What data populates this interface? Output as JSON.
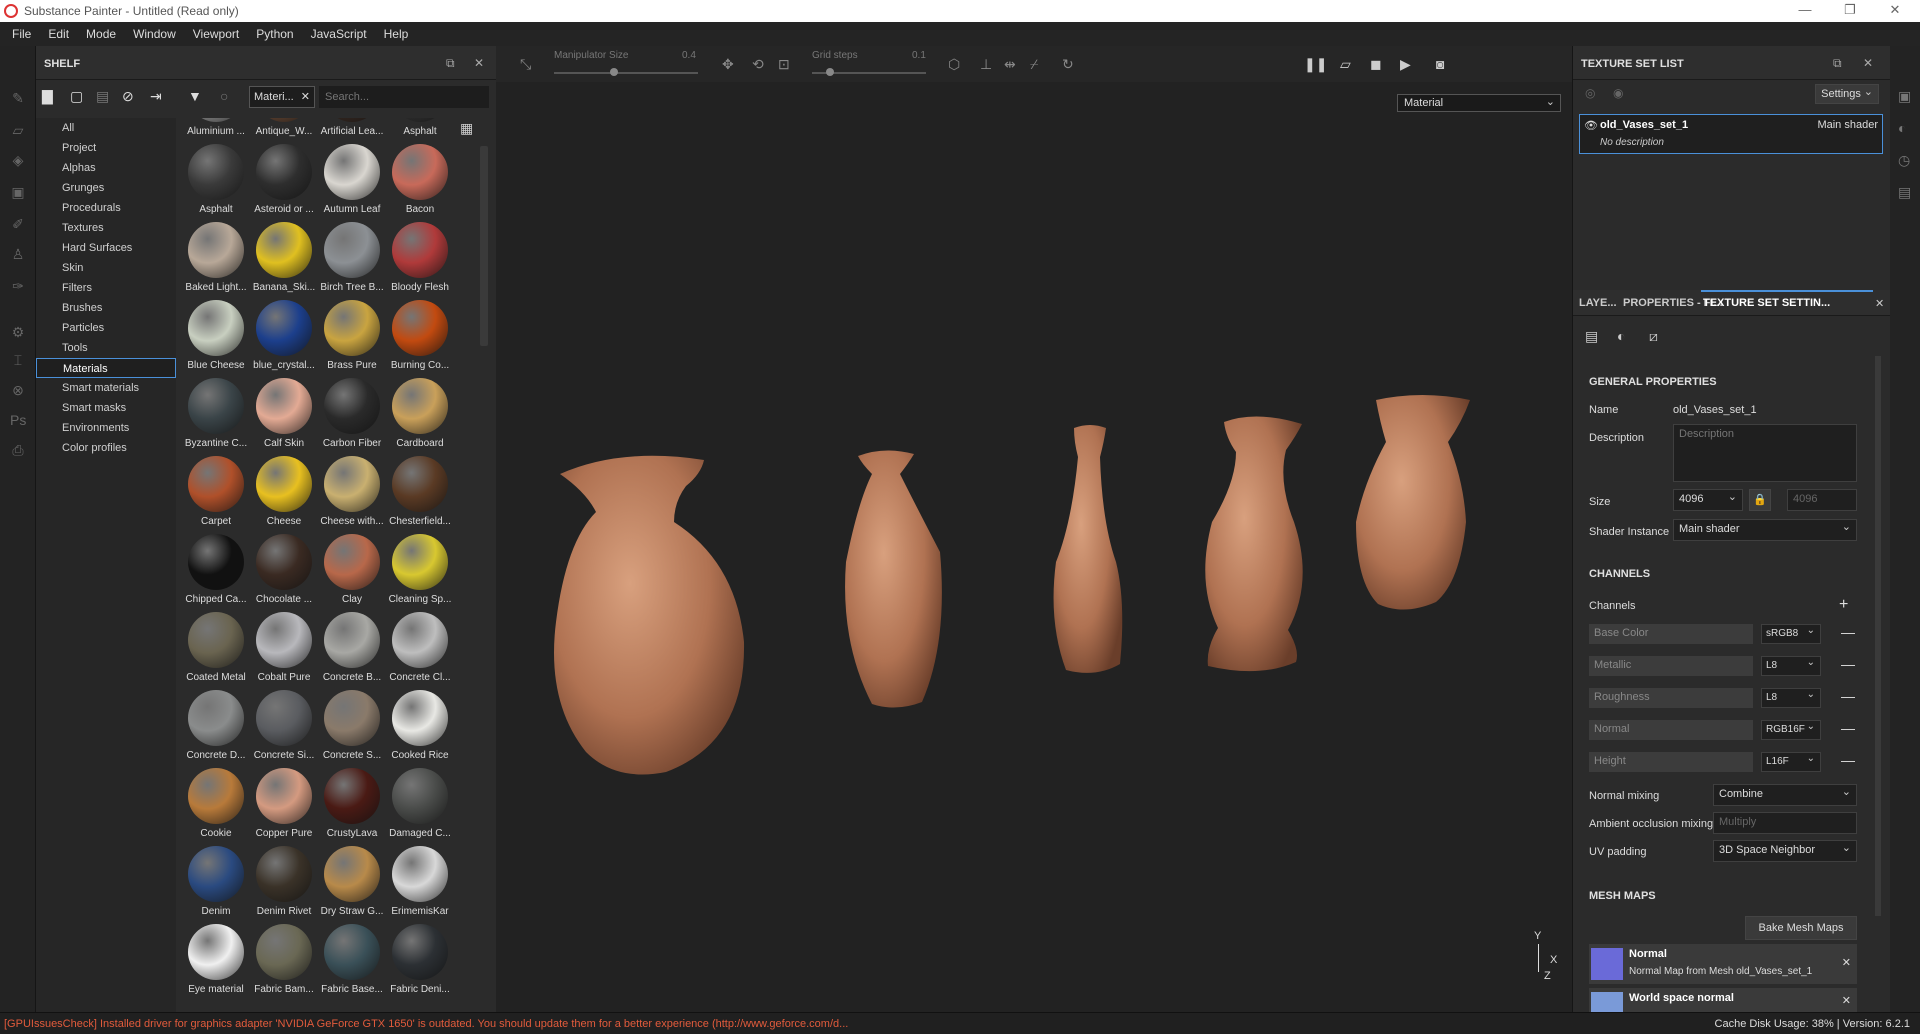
{
  "window": {
    "title": "Substance Painter - Untitled (Read only)"
  },
  "menu": [
    "File",
    "Edit",
    "Mode",
    "Window",
    "Viewport",
    "Python",
    "JavaScript",
    "Help"
  ],
  "shelf": {
    "title": "SHELF",
    "filter_chip": "Materi...",
    "search_placeholder": "Search...",
    "categories": [
      "All",
      "Project",
      "Alphas",
      "Grunges",
      "Procedurals",
      "Textures",
      "Hard Surfaces",
      "Skin",
      "Filters",
      "Brushes",
      "Particles",
      "Tools",
      "Materials",
      "Smart materials",
      "Smart masks",
      "Environments",
      "Color profiles"
    ],
    "selected_category": "Materials",
    "materials": [
      {
        "name": "Aluminium ...",
        "color": "#9a9a9a"
      },
      {
        "name": "Antique_W...",
        "color": "#6b4a35"
      },
      {
        "name": "Artificial Lea...",
        "color": "#3a2a22"
      },
      {
        "name": "Asphalt",
        "color": "#333333"
      },
      {
        "name": "Asphalt",
        "color": "#3a3a3a"
      },
      {
        "name": "Asteroid or ...",
        "color": "#2e2e2e"
      },
      {
        "name": "Autumn Leaf",
        "color": "#d9d6d0"
      },
      {
        "name": "Bacon",
        "color": "#c86a5a"
      },
      {
        "name": "Baked Light...",
        "color": "#b8a898"
      },
      {
        "name": "Banana_Ski...",
        "color": "#e0c020"
      },
      {
        "name": "Birch Tree B...",
        "color": "#8c9094"
      },
      {
        "name": "Bloody Flesh",
        "color": "#b03a3a"
      },
      {
        "name": "Blue Cheese",
        "color": "#c8cfc0"
      },
      {
        "name": "blue_crystal...",
        "color": "#1c3f8c"
      },
      {
        "name": "Brass Pure",
        "color": "#c9a440"
      },
      {
        "name": "Burning Co...",
        "color": "#c24a10"
      },
      {
        "name": "Byzantine C...",
        "color": "#3a4448"
      },
      {
        "name": "Calf Skin",
        "color": "#e3aa94"
      },
      {
        "name": "Carbon Fiber",
        "color": "#2a2a2a"
      },
      {
        "name": "Cardboard",
        "color": "#c9a05a"
      },
      {
        "name": "Carpet",
        "color": "#b0502a"
      },
      {
        "name": "Cheese",
        "color": "#e8c020"
      },
      {
        "name": "Cheese with...",
        "color": "#c9b070"
      },
      {
        "name": "Chesterfield...",
        "color": "#5a3a24"
      },
      {
        "name": "Chipped Ca...",
        "color": "#111111"
      },
      {
        "name": "Chocolate ...",
        "color": "#3a2a22"
      },
      {
        "name": "Clay",
        "color": "#b8684a"
      },
      {
        "name": "Cleaning Sp...",
        "color": "#d8c830"
      },
      {
        "name": "Coated Metal",
        "color": "#6a6450"
      },
      {
        "name": "Cobalt Pure",
        "color": "#b8b8bc"
      },
      {
        "name": "Concrete B...",
        "color": "#a8a8a4"
      },
      {
        "name": "Concrete Cl...",
        "color": "#bebebe"
      },
      {
        "name": "Concrete D...",
        "color": "#8a8c8c"
      },
      {
        "name": "Concrete Si...",
        "color": "#5a5c60"
      },
      {
        "name": "Concrete S...",
        "color": "#8a7a6a"
      },
      {
        "name": "Cooked Rice",
        "color": "#e8e8e4"
      },
      {
        "name": "Cookie",
        "color": "#b87a3a"
      },
      {
        "name": "Copper Pure",
        "color": "#d49a80"
      },
      {
        "name": "CrustyLava",
        "color": "#4a1a14"
      },
      {
        "name": "Damaged C...",
        "color": "#4a4c4a"
      },
      {
        "name": "Denim",
        "color": "#2a4a80"
      },
      {
        "name": "Denim Rivet",
        "color": "#3a3228"
      },
      {
        "name": "Dry Straw G...",
        "color": "#b88a4a"
      },
      {
        "name": "ErimemisKar",
        "color": "#d8d8d8"
      },
      {
        "name": "Eye material",
        "color": "#f0f0f0"
      },
      {
        "name": "Fabric Bam...",
        "color": "#6a6854"
      },
      {
        "name": "Fabric Base...",
        "color": "#3a5058"
      },
      {
        "name": "Fabric Deni...",
        "color": "#2c3034"
      }
    ]
  },
  "viewport_toolbar": {
    "manipulator_label": "Manipulator Size",
    "manipulator_value": "0.4",
    "grid_label": "Grid steps",
    "grid_value": "0.1",
    "material_mode": "Material"
  },
  "texture_set_list": {
    "title": "TEXTURE SET LIST",
    "settings_label": "Settings",
    "set_name": "old_Vases_set_1",
    "shader": "Main shader",
    "description": "No description"
  },
  "tabs": [
    "LAYE...",
    "PROPERTIES - FI...",
    "TEXTURE SET SETTIN..."
  ],
  "settings": {
    "general_title": "GENERAL PROPERTIES",
    "name_label": "Name",
    "name_value": "old_Vases_set_1",
    "description_label": "Description",
    "description_placeholder": "Description",
    "size_label": "Size",
    "size_value": "4096",
    "size_value2": "4096",
    "shader_label": "Shader Instance",
    "shader_value": "Main shader",
    "channels_title": "CHANNELS",
    "channels_label": "Channels",
    "channels": [
      {
        "name": "Base Color",
        "format": "sRGB8"
      },
      {
        "name": "Metallic",
        "format": "L8"
      },
      {
        "name": "Roughness",
        "format": "L8"
      },
      {
        "name": "Normal",
        "format": "RGB16F"
      },
      {
        "name": "Height",
        "format": "L16F"
      }
    ],
    "normal_mixing_label": "Normal mixing",
    "normal_mixing_value": "Combine",
    "ao_mixing_label": "Ambient occlusion mixing",
    "ao_mixing_value": "Multiply",
    "uv_padding_label": "UV padding",
    "uv_padding_value": "3D Space Neighbor",
    "mesh_maps_title": "MESH MAPS",
    "bake_button": "Bake Mesh Maps",
    "mesh_map1_title": "Normal",
    "mesh_map1_sub": "Normal Map from Mesh old_Vases_set_1",
    "mesh_map2_title": "World space normal"
  },
  "status": {
    "error": "[GPUIssuesCheck] Installed driver for graphics adapter 'NVIDIA GeForce GTX 1650' is outdated. You should update them for a better experience (http://www.geforce.com/d...",
    "cache": "Cache Disk Usage:   38% | Version: 6.2.1"
  },
  "axis": {
    "y": "Y",
    "x": "X",
    "z": "Z"
  }
}
